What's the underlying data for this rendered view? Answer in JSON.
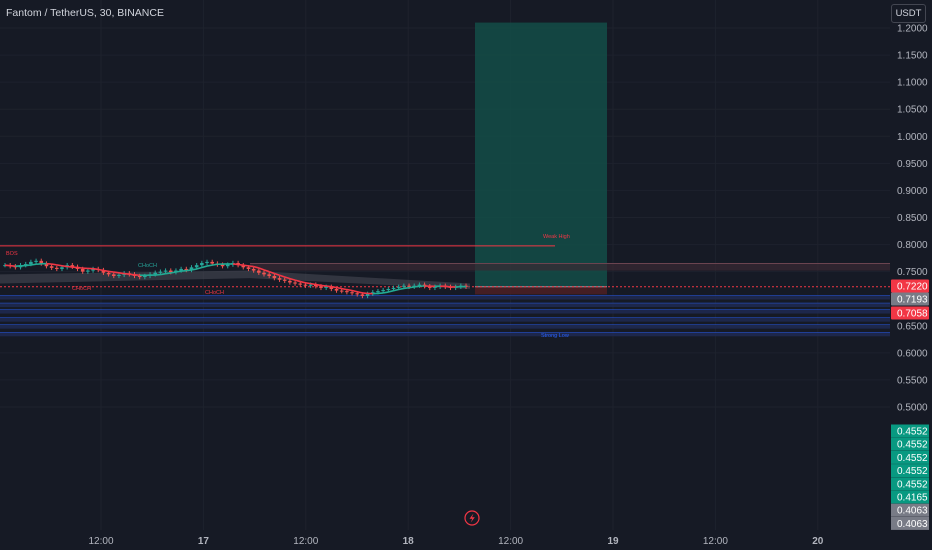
{
  "header": {
    "title": "Fantom / TetherUS, 30, BINANCE",
    "currency_button": "USDT"
  },
  "colors": {
    "background": "#161a25",
    "grid": "#1e222d",
    "axis_text": "#b2b5be",
    "up": "#26a69a",
    "down": "#ef5350",
    "red_line": "#f23645",
    "blue_line": "#2962ff",
    "gray_tag": "#787b86",
    "target_zone": "#134d48",
    "stop_zone": "#4a1f24"
  },
  "chart_data": {
    "type": "candlestick",
    "instrument": "Fantom / TetherUS",
    "interval": "30",
    "exchange": "BINANCE",
    "ylim": [
      0.4,
      1.22
    ],
    "y_ticks": [
      "1.2000",
      "1.1500",
      "1.1000",
      "1.0500",
      "1.0000",
      "0.9500",
      "0.9000",
      "0.8500",
      "0.8000",
      "0.7500",
      "0.7000",
      "0.6500",
      "0.6000",
      "0.5500",
      "0.5000"
    ],
    "x_ticks": [
      {
        "label": "12:00",
        "bold": false
      },
      {
        "label": "17",
        "bold": true
      },
      {
        "label": "12:00",
        "bold": false
      },
      {
        "label": "18",
        "bold": true
      },
      {
        "label": "12:00",
        "bold": false
      },
      {
        "label": "19",
        "bold": true
      },
      {
        "label": "12:00",
        "bold": false
      },
      {
        "label": "20",
        "bold": true
      }
    ],
    "price_tags": [
      {
        "label": "0.7220",
        "value": 0.722,
        "color": "#f23645"
      },
      {
        "label": "0.7193",
        "value": 0.7193,
        "color": "#787b86"
      },
      {
        "label": "0.7058",
        "value": 0.7058,
        "color": "#f23645"
      }
    ],
    "bottom_tags": [
      {
        "label": "0.4552",
        "color": "#089981"
      },
      {
        "label": "0.4552",
        "color": "#089981"
      },
      {
        "label": "0.4552",
        "color": "#089981"
      },
      {
        "label": "0.4552",
        "color": "#089981"
      },
      {
        "label": "0.4552",
        "color": "#089981"
      },
      {
        "label": "0.4165",
        "color": "#089981"
      },
      {
        "label": "0.4063",
        "color": "#787b86"
      },
      {
        "label": "0.4063",
        "color": "#787b86"
      }
    ],
    "series": [
      {
        "name": "",
        "close": [
          0.762,
          0.76,
          0.758,
          0.762,
          0.764,
          0.768,
          0.77,
          0.765,
          0.76,
          0.757,
          0.755,
          0.758,
          0.762,
          0.759,
          0.755,
          0.75,
          0.752,
          0.755,
          0.753,
          0.748,
          0.745,
          0.742,
          0.744,
          0.747,
          0.745,
          0.742,
          0.74,
          0.742,
          0.745,
          0.748,
          0.75,
          0.752,
          0.749,
          0.752,
          0.755,
          0.753,
          0.758,
          0.762,
          0.766,
          0.768,
          0.765,
          0.763,
          0.76,
          0.763,
          0.766,
          0.762,
          0.758,
          0.755,
          0.752,
          0.748,
          0.745,
          0.742,
          0.738,
          0.735,
          0.733,
          0.73,
          0.728,
          0.726,
          0.724,
          0.726,
          0.723,
          0.72,
          0.722,
          0.718,
          0.715,
          0.714,
          0.712,
          0.71,
          0.708,
          0.705,
          0.709,
          0.712,
          0.714,
          0.716,
          0.718,
          0.72,
          0.722,
          0.724,
          0.722,
          0.724,
          0.726,
          0.723,
          0.72,
          0.722,
          0.724,
          0.722,
          0.72,
          0.722,
          0.724,
          0.722
        ]
      }
    ],
    "annotations": [
      "BOS",
      "CHoCH",
      "CHoCH",
      "CHoCH",
      "Weak High",
      "Strong Low"
    ],
    "levels": {
      "weak_high": 0.7975,
      "target_top": 1.21,
      "position_entry": 0.722,
      "stop": 0.708
    }
  }
}
